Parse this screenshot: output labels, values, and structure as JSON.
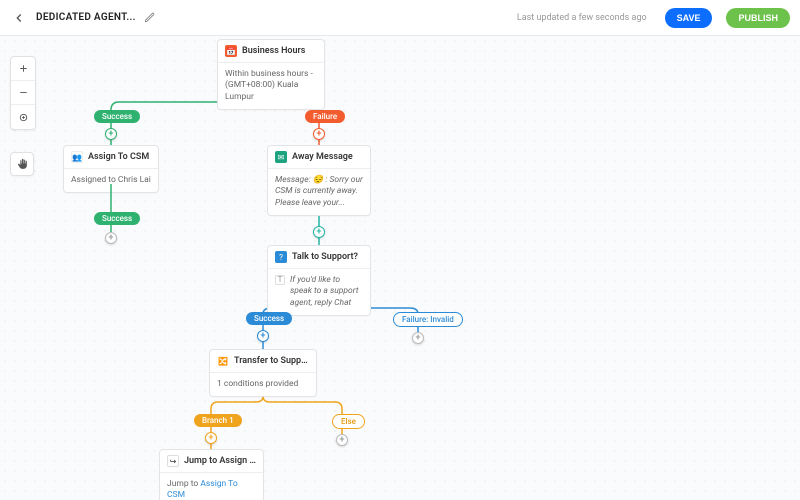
{
  "header": {
    "title": "DEDICATED AGENT...",
    "last_updated": "Last updated a few seconds ago",
    "save_label": "SAVE",
    "publish_label": "PUBLISH"
  },
  "nodes": {
    "business_hours": {
      "title": "Business Hours",
      "body": "Within business hours - (GMT+08:00) Kuala Lumpur"
    },
    "assign_csm": {
      "title": "Assign To CSM",
      "body": "Assigned to Chris Lai"
    },
    "away_msg": {
      "title": "Away Message",
      "body": "Message: 😔 : Sorry our CSM is currently away. Please leave your..."
    },
    "talk_support": {
      "title": "Talk to Support?",
      "body": "If you'd like to speak to a support agent, reply Chat"
    },
    "transfer": {
      "title": "Transfer to Support Bra...",
      "body": "1 conditions provided"
    },
    "jump": {
      "title": "Jump to Assign to CRM",
      "body_prefix": "Jump to ",
      "body_link": "Assign To CSM"
    }
  },
  "labels": {
    "success": "Success",
    "failure": "Failure",
    "failure_invalid": "Failure: Invalid",
    "branch1": "Branch 1",
    "else": "Else"
  }
}
